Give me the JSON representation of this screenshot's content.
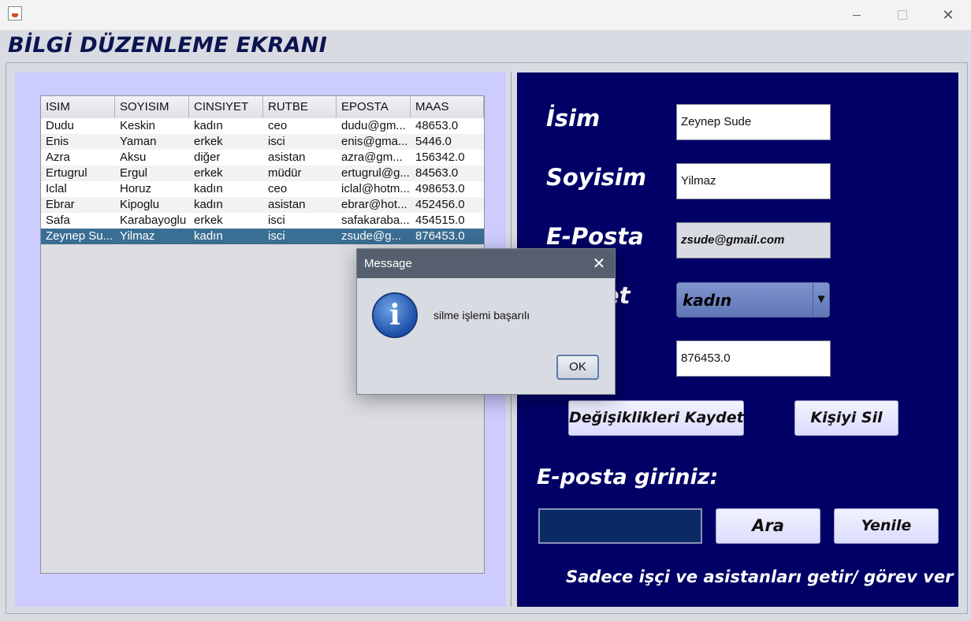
{
  "window": {
    "minimize_icon": "minimize-icon",
    "maximize_icon": "maximize-icon",
    "close_icon": "close-icon",
    "close_glyph": "✕"
  },
  "page": {
    "title": "BİLGİ DÜZENLEME EKRANI"
  },
  "table": {
    "columns": [
      "ISIM",
      "SOYISIM",
      "CINSIYET",
      "RUTBE",
      "EPOSTA",
      "MAAS"
    ],
    "rows": [
      [
        "Dudu",
        "Keskin",
        "kadın",
        "ceo",
        "dudu@gm...",
        "48653.0"
      ],
      [
        "Enis",
        "Yaman",
        "erkek",
        "isci",
        "enis@gma...",
        "5446.0"
      ],
      [
        "Azra",
        "Aksu",
        "diğer",
        "asistan",
        "azra@gm...",
        "156342.0"
      ],
      [
        "Ertugrul",
        "Ergul",
        "erkek",
        "müdür",
        "ertugrul@g...",
        "84563.0"
      ],
      [
        "Iclal",
        "Horuz",
        "kadın",
        "ceo",
        "iclal@hotm...",
        "498653.0"
      ],
      [
        "Ebrar",
        "Kipoglu",
        "kadın",
        "asistan",
        "ebrar@hot...",
        "452456.0"
      ],
      [
        "Safa",
        "Karabayoglu",
        "erkek",
        "isci",
        "safakaraba...",
        "454515.0"
      ],
      [
        "Zeynep Su...",
        "Yilmaz",
        "kadın",
        "isci",
        "zsude@g...",
        "876453.0"
      ]
    ],
    "selected_row": 7
  },
  "form": {
    "isim_label": "İsim",
    "isim_value": "Zeynep Sude",
    "soyisim_label": "Soyisim",
    "soyisim_value": "Yilmaz",
    "eposta_label": "E-Posta",
    "eposta_value": "zsude@gmail.com",
    "cinsiyet_label_visible": "et",
    "cinsiyet_value": "kadın",
    "maas_value": "876453.0",
    "save_button": "Değişiklikleri Kaydet",
    "delete_button": "Kişiyi Sil",
    "search_label": "E-posta giriniz:",
    "search_value": "",
    "search_button": "Ara",
    "refresh_button": "Yenile",
    "footer": "Sadece işçi ve asistanları getir/ görev ver"
  },
  "dialog": {
    "title": "Message",
    "close_glyph": "✕",
    "icon": "info-icon",
    "icon_glyph": "i",
    "message": "silme işlemi başarılı",
    "ok_button": "OK"
  },
  "colors": {
    "left_panel": "#ccccff",
    "right_panel": "#000066",
    "selected_row": "#3b6e93",
    "dialog_titlebar": "#565f6e"
  }
}
